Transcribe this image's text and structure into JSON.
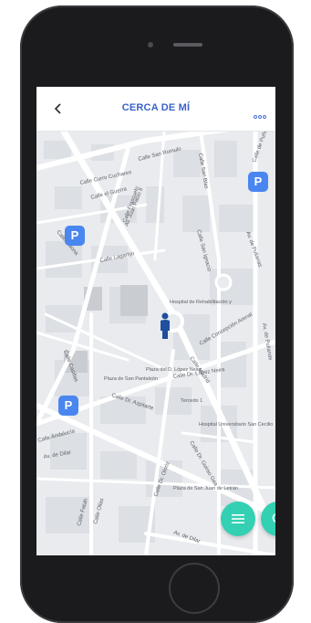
{
  "header": {
    "title": "CERCA DE MÍ",
    "back_icon": "chevron-left-icon",
    "more_icon": "more-dots-icon",
    "title_color": "#3a63c8"
  },
  "map": {
    "streets": [
      "Calle San Romulo",
      "Calle Curro Cuchares",
      "Calle el Guerra",
      "Calle Frascuelo",
      "Calle Lagartijo",
      "Calle Gaona",
      "Calle San Blas",
      "Calle de Puñonrostro",
      "Av. de Pulianas",
      "Av. de Pulianas",
      "Calle Concepción Arenal",
      "Calle Madrid",
      "Calle Dr. Azpitarte",
      "Calle San Ignacio",
      "Av. Juan Pablo II",
      "Calle Dr. Oloriz",
      "Calle Dr. Guirao Gea",
      "Calle Casillas",
      "Calle Fatah",
      "Calle Ollas",
      "Calle Andalucía",
      "Av. de Dilar",
      "Calle Dr. López Neira",
      "Av. de Dilar"
    ],
    "pois": [
      "Hospital de Rehabilitación y",
      "Plaza del D. López Neira",
      "Plaza de San Pantaleón",
      "Plaza de San Juan de Letrán",
      "Hospital Universitario San Cecilio",
      "Tercedo 1",
      "Plaza Tercedo"
    ],
    "parking_label": "P",
    "parking_color": "#4a86f0",
    "user_marker_icon": "person-pin-icon"
  },
  "fabs": {
    "list_icon": "list-icon",
    "search_icon": "search-icon",
    "color": "#33d0b3"
  }
}
